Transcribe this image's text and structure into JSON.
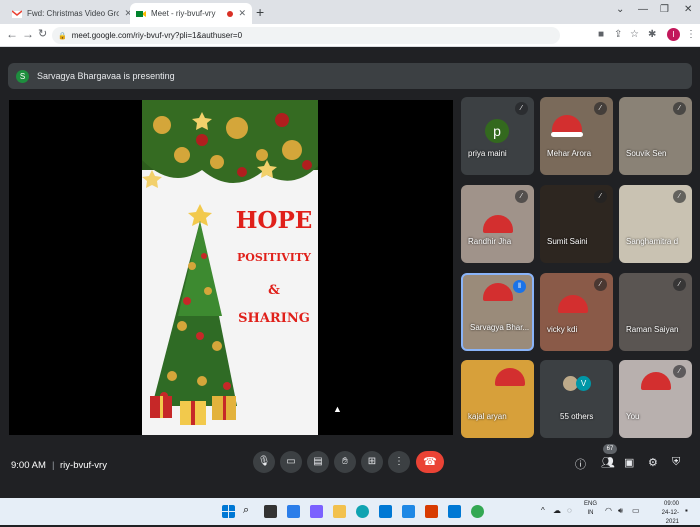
{
  "browser": {
    "tabs": [
      {
        "title": "Fwd: Christmas Video Group A a",
        "favicon": "gmail-icon"
      },
      {
        "title": "Meet - riy-bvuf-vry",
        "favicon": "meet-icon"
      }
    ],
    "address": "meet.google.com/riy-bvuf-vry?pli=1&authuser=0",
    "profile_initial": "I"
  },
  "meeting": {
    "presenting_initial": "S",
    "presenting_text": "Sarvagya Bhargavaa is presenting",
    "slide": {
      "line1": "HOPE",
      "line2": "POSITIVITY",
      "line3": "&",
      "line4": "SHARING"
    },
    "participants": [
      {
        "name": "priya maini",
        "initial": "p"
      },
      {
        "name": "Mehar Arora"
      },
      {
        "name": "Souvik Sen"
      },
      {
        "name": "Randhir Jha"
      },
      {
        "name": "Sumit Saini"
      },
      {
        "name": "Sanghamitra d"
      },
      {
        "name": "Sarvagya Bhar..."
      },
      {
        "name": "vicky kdi"
      },
      {
        "name": "Raman Saiyan"
      },
      {
        "name": "kajal aryan"
      },
      {
        "name": "55 others",
        "initial": "V"
      },
      {
        "name": "You"
      }
    ],
    "time": "9:00 AM",
    "separator": "|",
    "code": "riy-bvuf-vry",
    "participant_count": "67"
  },
  "taskbar": {
    "lang_line1": "ENG",
    "lang_line2": "IN",
    "time": "09:00",
    "date": "24-12-2021"
  },
  "colors": {
    "accent": "#8ab4f8",
    "end_call": "#ea4335",
    "slide_text": "#e0201a"
  }
}
